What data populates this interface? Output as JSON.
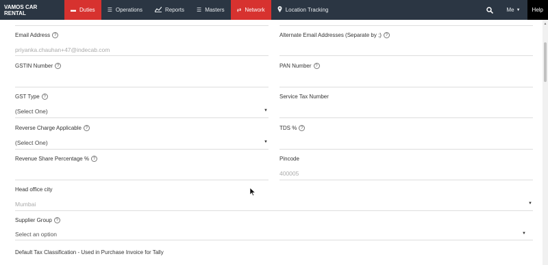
{
  "nav": {
    "brand": "VAMOS CAR RENTAL",
    "items": [
      {
        "label": "Duties",
        "active": true
      },
      {
        "label": "Operations",
        "active": false
      },
      {
        "label": "Reports",
        "active": false
      },
      {
        "label": "Masters",
        "active": false
      },
      {
        "label": "Network",
        "active": true
      },
      {
        "label": "Location Tracking",
        "active": false
      }
    ],
    "me_label": "Me",
    "help_label": "Help"
  },
  "form": {
    "email": {
      "label": "Email Address",
      "value": "priyanka.chauhan+47@indecab.com"
    },
    "alt_email": {
      "label": "Alternate Email Addresses (Separate by ;)",
      "value": ""
    },
    "gstin": {
      "label": "GSTIN Number",
      "value": ""
    },
    "pan": {
      "label": "PAN Number",
      "value": ""
    },
    "gst_type": {
      "label": "GST Type",
      "value": "(Select One)"
    },
    "service_tax": {
      "label": "Service Tax Number",
      "value": ""
    },
    "reverse_charge": {
      "label": "Reverse Charge Applicable",
      "value": "(Select One)"
    },
    "tds": {
      "label": "TDS %",
      "value": ""
    },
    "revenue_share": {
      "label": "Revenue Share Percentage %",
      "value": ""
    },
    "pincode": {
      "label": "Pincode",
      "value": "400005"
    },
    "head_office_city": {
      "label": "Head office city",
      "value": "Mumbai"
    },
    "supplier_group": {
      "label": "Supplier Group",
      "value": "Select an option"
    },
    "default_tax": {
      "label": "Default Tax Classification - Used in Purchase Invoice for Tally"
    }
  }
}
